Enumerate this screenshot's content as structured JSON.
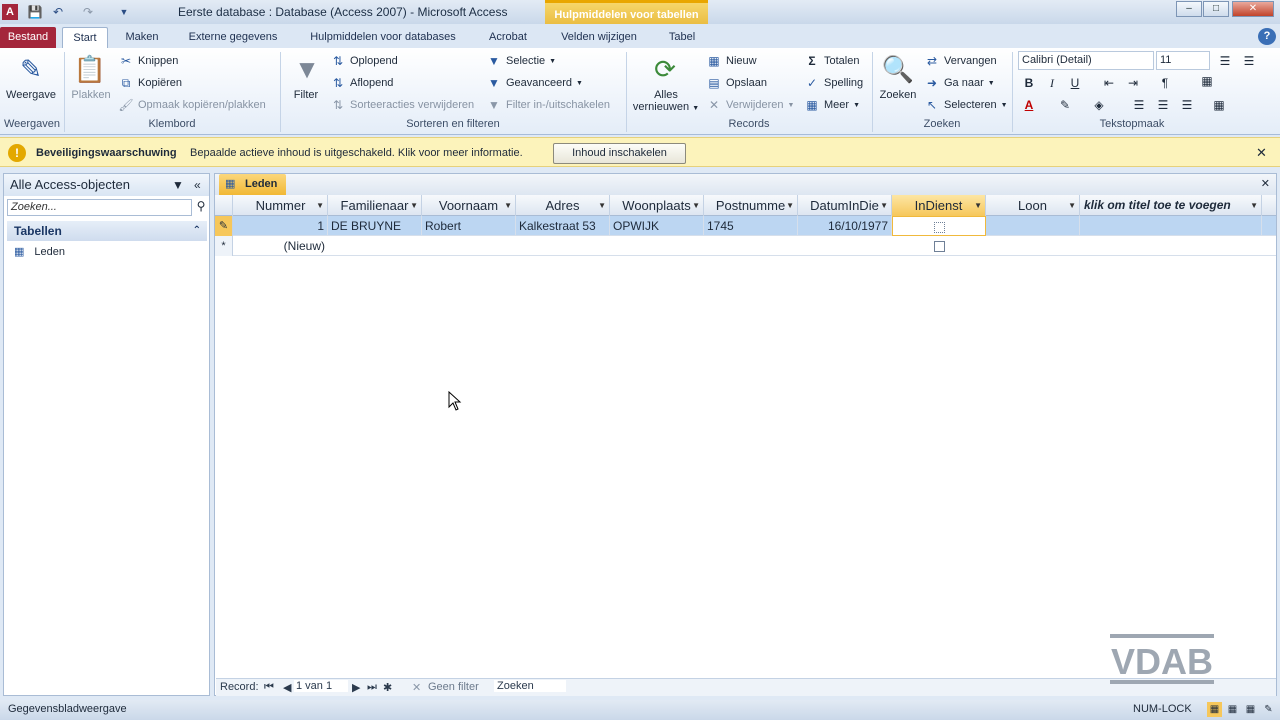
{
  "titlebar": {
    "title": "Eerste database : Database (Access 2007)  -  Microsoft Access",
    "context_tab_header": "Hulpmiddelen voor tabellen",
    "app_icon": "access-icon",
    "min": "–",
    "max": "□",
    "close": "✕"
  },
  "tabs": {
    "file": "Bestand",
    "items": [
      "Start",
      "Maken",
      "Externe gegevens",
      "Hulpmiddelen voor databases",
      "Acrobat",
      "Velden wijzigen",
      "Tabel"
    ],
    "help": "?"
  },
  "ribbon": {
    "weergaven": {
      "button": "Weergave",
      "label": "Weergaven"
    },
    "klembord": {
      "paste": "Plakken",
      "cut": "Knippen",
      "copy": "Kopiëren",
      "format_painter": "Opmaak kopiëren/plakken",
      "label": "Klembord"
    },
    "sorteren": {
      "filter": "Filter",
      "asc": "Oplopend",
      "desc": "Aflopend",
      "remove_sort": "Sorteeracties verwijderen",
      "selection": "Selectie",
      "advanced": "Geavanceerd",
      "toggle_filter": "Filter in-/uitschakelen",
      "label": "Sorteren en filteren"
    },
    "records": {
      "refresh_line1": "Alles",
      "refresh_line2": "vernieuwen",
      "new": "Nieuw",
      "save": "Opslaan",
      "delete": "Verwijderen",
      "totals": "Totalen",
      "spelling": "Spelling",
      "more": "Meer",
      "label": "Records"
    },
    "zoeken": {
      "find": "Zoeken",
      "replace": "Vervangen",
      "goto": "Ga naar",
      "select": "Selecteren",
      "label": "Zoeken"
    },
    "tekstopmaak": {
      "font": "Calibri (Detail)",
      "size": "11",
      "bold": "B",
      "italic": "I",
      "underline": "U",
      "label": "Tekstopmaak"
    }
  },
  "message_bar": {
    "title": "Beveiligingswaarschuwing",
    "text": "Bepaalde actieve inhoud is uitgeschakeld. Klik voor meer informatie.",
    "button": "Inhoud inschakelen",
    "close": "✕"
  },
  "nav_pane": {
    "header": "Alle Access-objecten",
    "search_placeholder": "Zoeken...",
    "section": "Tabellen",
    "items": [
      "Leden"
    ]
  },
  "document": {
    "tab": "Leden",
    "columns": [
      "Nummer",
      "Familienaar",
      "Voornaam",
      "Adres",
      "Woonplaats",
      "Postnumme",
      "DatumInDie",
      "InDienst",
      "Loon",
      "klik om titel toe te voegen"
    ],
    "rows": [
      {
        "Nummer": "1",
        "Familienaar": "DE BRUYNE",
        "Voornaam": "Robert",
        "Adres": "Kalkestraat 53",
        "Woonplaats": "OPWIJK",
        "Postnumme": "1745",
        "DatumInDie": "16/10/1977",
        "InDienst": false,
        "Loon": ""
      }
    ],
    "new_row_label": "(Nieuw)"
  },
  "record_nav": {
    "label": "Record:",
    "position": "1 van 1",
    "filter": "Geen filter",
    "search": "Zoeken"
  },
  "status": {
    "left": "Gegevensbladweergave",
    "right": "NUM-LOCK"
  },
  "watermark": "VDAB"
}
